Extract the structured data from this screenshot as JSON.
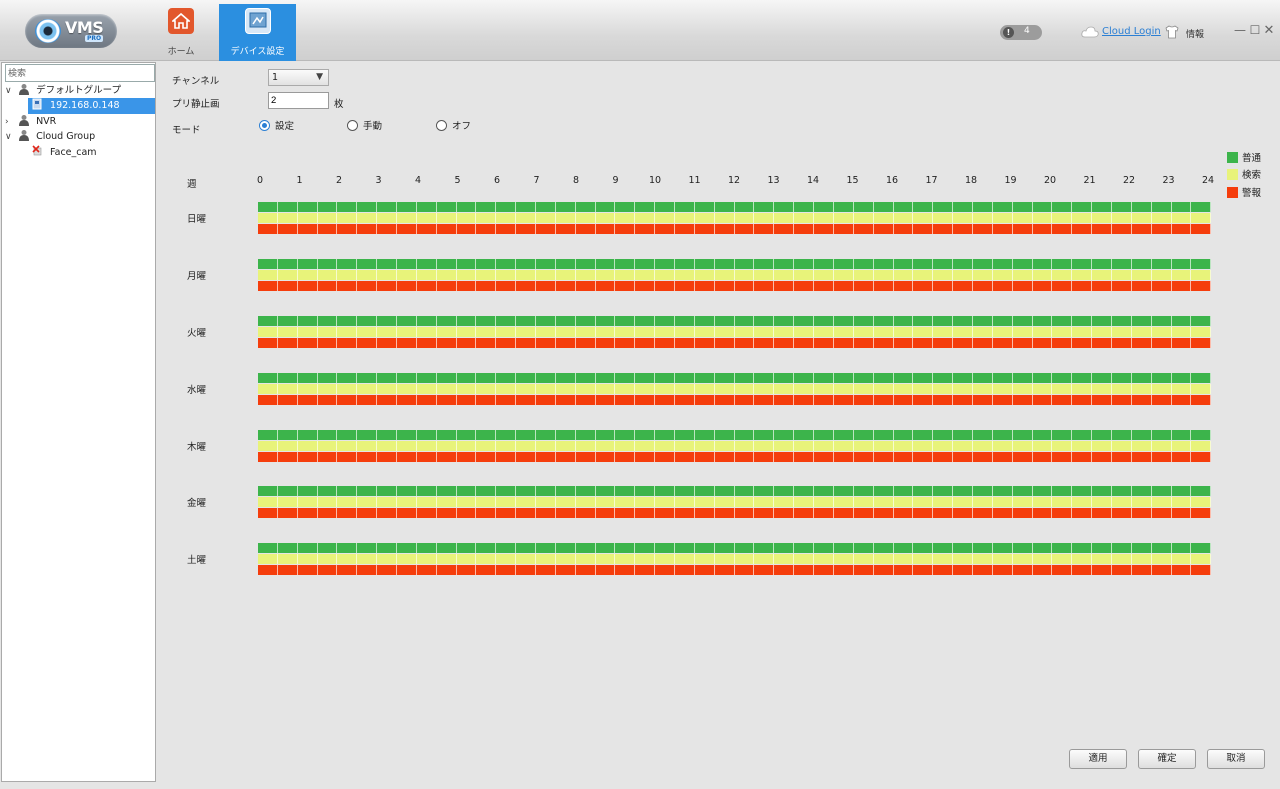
{
  "app": {
    "logo_text": "VMS",
    "logo_sub": "PRO",
    "nav": [
      {
        "label": "ホーム",
        "icon": "home-icon"
      },
      {
        "label": "デバイス設定",
        "icon": "device-settings-icon"
      }
    ],
    "alarm_count": "4",
    "alarm_icon_glyph": "!",
    "cloud_login": "Cloud Login",
    "info": "情報",
    "window_controls": {
      "minimize": "—",
      "maximize": "☐",
      "close": "✕"
    }
  },
  "sidebar": {
    "search_placeholder": "検索",
    "tree": [
      {
        "label": "デフォルトグループ",
        "arrow": "∨"
      },
      {
        "label": "192.168.0.148"
      },
      {
        "label": "NVR",
        "arrow": "›"
      },
      {
        "label": "Cloud Group",
        "arrow": "∨"
      },
      {
        "label": "Face_cam"
      }
    ]
  },
  "form": {
    "channel_label": "チャンネル",
    "channel_value": "1",
    "channel_caret": "▼",
    "prerecord_label": "プリ静止画",
    "prerecord_value": "2",
    "prerecord_unit": "枚",
    "mode_label": "モード",
    "modes": [
      "設定",
      "手動",
      "オフ"
    ],
    "selected_mode": "設定"
  },
  "schedule": {
    "week_label": "週",
    "hours": [
      "0",
      "1",
      "2",
      "3",
      "4",
      "5",
      "6",
      "7",
      "8",
      "9",
      "10",
      "11",
      "12",
      "13",
      "14",
      "15",
      "16",
      "17",
      "18",
      "19",
      "20",
      "21",
      "22",
      "23",
      "24"
    ],
    "days": [
      "日曜",
      "月曜",
      "火曜",
      "水曜",
      "木曜",
      "金曜",
      "土曜"
    ],
    "legend": [
      {
        "label": "普通",
        "color": "#3cb44b"
      },
      {
        "label": "検索",
        "color": "#e8f37a"
      },
      {
        "label": "警報",
        "color": "#f53d0c"
      }
    ]
  },
  "buttons": {
    "apply": "適用",
    "ok": "確定",
    "cancel": "取消"
  }
}
